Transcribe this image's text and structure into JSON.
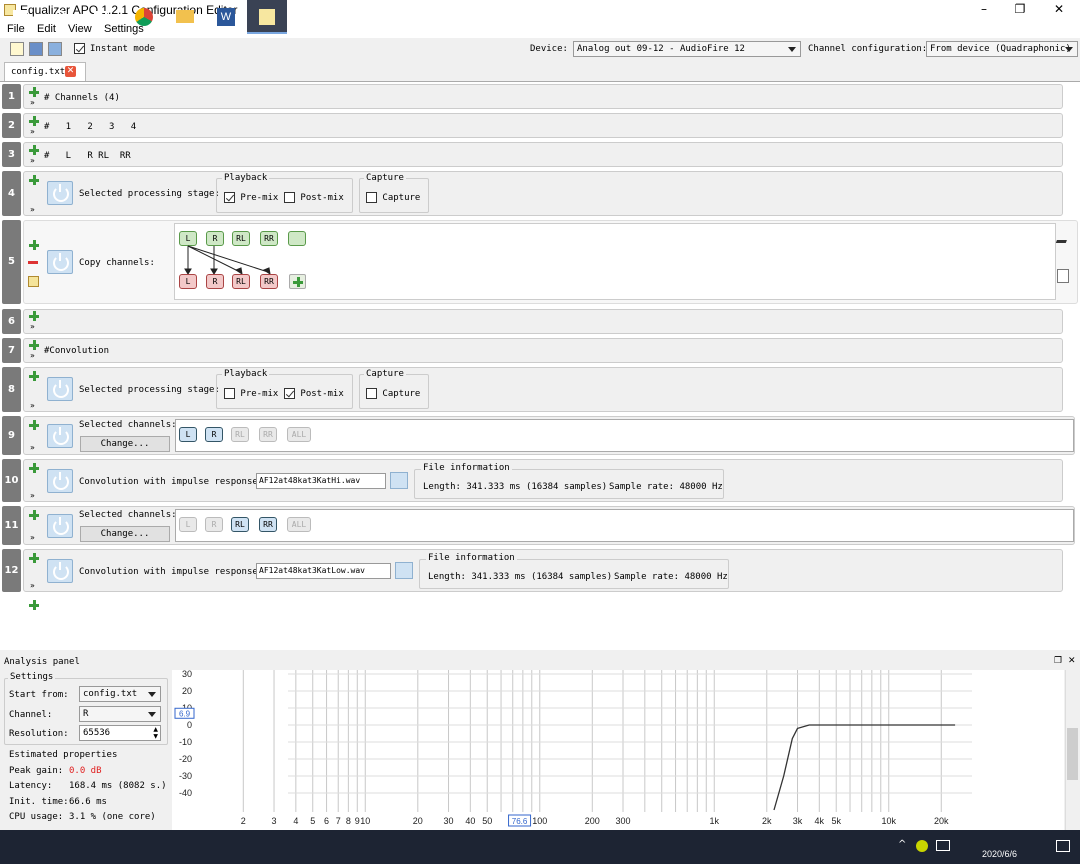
{
  "window": {
    "title": "Equalizer APO 1.2.1 Configuration Editor",
    "minimize": "–",
    "maximize": "❐",
    "close": "✕"
  },
  "menu": [
    "File",
    "Edit",
    "View",
    "Settings"
  ],
  "toolbar": {
    "instant_mode_label": "Instant mode",
    "instant_mode_checked": true,
    "device_label": "Device:",
    "device_value": "Analog out 09-12 - AudioFire 12",
    "channel_config_label": "Channel configuration:",
    "channel_config_value": "From device (Quadraphonic)"
  },
  "tab": {
    "label": "config.txt"
  },
  "rows": [
    {
      "num": "1",
      "text": "# Channels (4)"
    },
    {
      "num": "2",
      "text": "#   1   2   3   4"
    },
    {
      "num": "3",
      "text": "#   L   R RL  RR"
    },
    {
      "num": "4",
      "stage_label": "Selected processing stage:",
      "playback_title": "Playback",
      "premix": "Pre-mix",
      "postmix": "Post-mix",
      "capture_title": "Capture",
      "capture": "Capture"
    },
    {
      "num": "5",
      "label": "Copy channels:",
      "top": [
        "L",
        "R",
        "RL",
        "RR",
        ""
      ],
      "bottom": [
        "L",
        "R",
        "RL",
        "RR"
      ]
    },
    {
      "num": "6",
      "text": ""
    },
    {
      "num": "7",
      "text": "#Convolution"
    },
    {
      "num": "8",
      "stage_label": "Selected processing stage:",
      "playback_title": "Playback",
      "premix": "Pre-mix",
      "postmix": "Post-mix",
      "capture_title": "Capture",
      "capture": "Capture"
    },
    {
      "num": "9",
      "label": "Selected channels:",
      "change": "Change...",
      "channels": [
        "L",
        "R",
        "RL",
        "RR",
        "ALL"
      ]
    },
    {
      "num": "10",
      "label": "Convolution with impulse response:",
      "file": "AF12at48kat3KatHi.wav",
      "info_title": "File information",
      "length": "Length: 341.333 ms (16384 samples)",
      "rate": "Sample rate: 48000 Hz"
    },
    {
      "num": "11",
      "label": "Selected channels:",
      "change": "Change...",
      "channels": [
        "L",
        "R",
        "RL",
        "RR",
        "ALL"
      ]
    },
    {
      "num": "12",
      "label": "Convolution with impulse response:",
      "file": "AF12at48kat3KatLow.wav",
      "info_title": "File information",
      "length": "Length: 341.333 ms (16384 samples)",
      "rate": "Sample rate: 48000 Hz"
    }
  ],
  "analysis": {
    "title": "Analysis panel",
    "settings_title": "Settings",
    "start_from_label": "Start from:",
    "start_from_value": "config.txt",
    "channel_label": "Channel:",
    "channel_value": "R",
    "resolution_label": "Resolution:",
    "resolution_value": "65536",
    "estimated_title": "Estimated properties",
    "peak_gain_label": "Peak gain:",
    "peak_gain_value": "0.0 dB",
    "latency_label": "Latency:",
    "latency_value": "168.4 ms (8082 s.)",
    "init_time_label": "Init. time:",
    "init_time_value": "66.6 ms",
    "cpu_label": "CPU usage:",
    "cpu_value": "3.1 % (one core)",
    "cursor_y": "6.9",
    "cursor_x": "76.6"
  },
  "chart_data": {
    "type": "line",
    "y_ticks": [
      "30",
      "20",
      "10",
      "0",
      "-10",
      "-20",
      "-30",
      "-40"
    ],
    "ylim": [
      -50,
      30
    ],
    "x_scale": "log",
    "x_ticks": [
      "2",
      "3",
      "4",
      "5",
      "6",
      "7",
      "8",
      "9",
      "10",
      "20",
      "30",
      "40",
      "50",
      "100",
      "200",
      "300",
      "1k",
      "2k",
      "3k",
      "4k",
      "5k",
      "10k",
      "20k"
    ],
    "x_tick_values": [
      2,
      3,
      4,
      5,
      6,
      7,
      8,
      9,
      10,
      20,
      30,
      40,
      50,
      100,
      200,
      300,
      1000,
      2000,
      3000,
      4000,
      5000,
      10000,
      20000
    ],
    "series": [
      {
        "x": [
          2200,
          2500,
          2800,
          3000,
          3500,
          5000,
          10000,
          24000
        ],
        "y": [
          -50,
          -30,
          -8,
          -2,
          0,
          0,
          0,
          0
        ]
      }
    ]
  },
  "taskbar": {
    "time": "2020/6/6"
  }
}
